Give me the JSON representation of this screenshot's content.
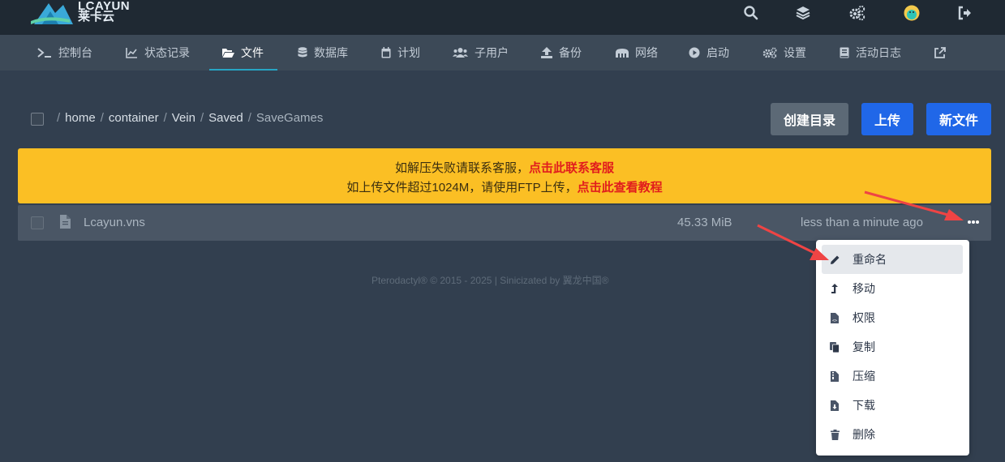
{
  "brand": {
    "name": "LCAYUN",
    "sub": "莱卡云"
  },
  "topbar_icons": [
    "search-icon",
    "layers-icon",
    "cogs-icon",
    "avatar",
    "sign-out-icon"
  ],
  "nav": [
    {
      "label": "控制台",
      "icon": "terminal-icon"
    },
    {
      "label": "状态记录",
      "icon": "chart-line-icon"
    },
    {
      "label": "文件",
      "icon": "folder-open-icon",
      "active": true
    },
    {
      "label": "数据库",
      "icon": "database-icon"
    },
    {
      "label": "计划",
      "icon": "calendar-icon"
    },
    {
      "label": "子用户",
      "icon": "users-icon"
    },
    {
      "label": "备份",
      "icon": "upload-icon"
    },
    {
      "label": "网络",
      "icon": "network-icon"
    },
    {
      "label": "启动",
      "icon": "play-circle-icon"
    },
    {
      "label": "设置",
      "icon": "cogs-icon"
    },
    {
      "label": "活动日志",
      "icon": "book-icon"
    },
    {
      "label": "",
      "icon": "external-link-icon"
    }
  ],
  "breadcrumb": {
    "separator": "/",
    "segments": [
      "home",
      "container",
      "Vein",
      "Saved",
      "SaveGames"
    ]
  },
  "actions": {
    "create_dir": "创建目录",
    "upload": "上传",
    "new_file": "新文件"
  },
  "notice": {
    "line1_text": "如解压失败请联系客服，",
    "line1_link": "点击此联系客服",
    "line2_text": "如上传文件超过1024M，请使用FTP上传，",
    "line2_link": "点击此查看教程",
    "color": "#fbbf24"
  },
  "files": [
    {
      "name": "Lcayun.vns",
      "size": "45.33 MiB",
      "modified": "less than a minute ago"
    }
  ],
  "footer": "Pterodactyl® © 2015 - 2025 | Sinicizated by 翼龙中国®",
  "context_menu": [
    {
      "label": "重命名",
      "icon": "pencil-icon"
    },
    {
      "label": "移动",
      "icon": "level-up-icon"
    },
    {
      "label": "权限",
      "icon": "file-code-icon"
    },
    {
      "label": "复制",
      "icon": "copy-icon"
    },
    {
      "label": "压缩",
      "icon": "file-archive-icon"
    },
    {
      "label": "下载",
      "icon": "file-download-icon"
    },
    {
      "label": "删除",
      "icon": "trash-icon"
    }
  ],
  "colors": {
    "accent": "#2067e8",
    "nav_active_underline": "#27a5c4",
    "annotation_arrow": "#ef4444"
  }
}
